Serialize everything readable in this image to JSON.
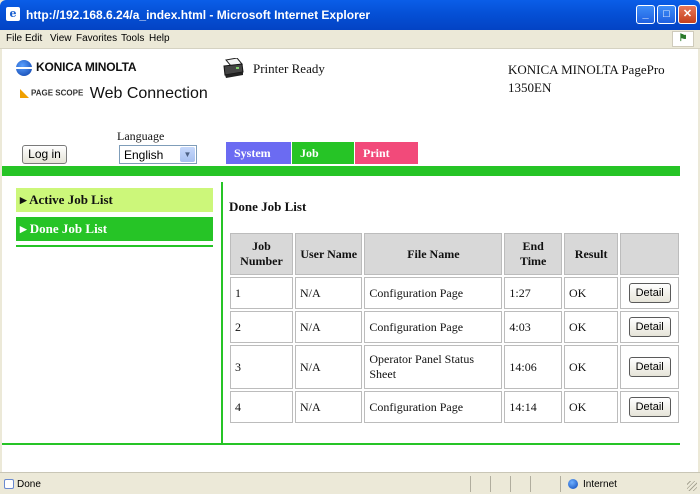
{
  "window": {
    "title": "http://192.168.6.24/a_index.html - Microsoft Internet Explorer"
  },
  "menu": [
    "File",
    "Edit",
    "View",
    "Favorites",
    "Tools",
    "Help"
  ],
  "header": {
    "brand": "KONICA MINOLTA",
    "product_mark": "PAGE SCOPE",
    "product": "Web Connection",
    "printer_status": "Printer Ready",
    "model": "KONICA MINOLTA PagePro 1350EN"
  },
  "controls": {
    "language_label": "Language",
    "login_label": "Log in",
    "language_value": "English"
  },
  "tabs": [
    {
      "label": "System",
      "color": "#6b6bf2"
    },
    {
      "label": "Job",
      "color": "#26c426"
    },
    {
      "label": "Print",
      "color": "#f24a7a"
    }
  ],
  "sidebar": {
    "items": [
      {
        "label": "Active Job List",
        "color": "#ccf77a"
      },
      {
        "label": "Done Job List",
        "color": "#26c426"
      }
    ]
  },
  "main": {
    "heading": "Done Job List",
    "columns": [
      "Job Number",
      "User Name",
      "File Name",
      "End Time",
      "Result",
      ""
    ],
    "rows": [
      {
        "job": "1",
        "user": "N/A",
        "file": "Configuration Page",
        "time": "1:27",
        "result": "OK",
        "action": "Detail"
      },
      {
        "job": "2",
        "user": "N/A",
        "file": "Configuration Page",
        "time": "4:03",
        "result": "OK",
        "action": "Detail"
      },
      {
        "job": "3",
        "user": "N/A",
        "file": "Operator Panel Status Sheet",
        "time": "14:06",
        "result": "OK",
        "action": "Detail"
      },
      {
        "job": "4",
        "user": "N/A",
        "file": "Configuration Page",
        "time": "14:14",
        "result": "OK",
        "action": "Detail"
      }
    ]
  },
  "statusbar": {
    "status": "Done",
    "zone": "Internet"
  },
  "colors": {
    "accent_green": "#26c426",
    "title_blue": "#0550d6"
  }
}
